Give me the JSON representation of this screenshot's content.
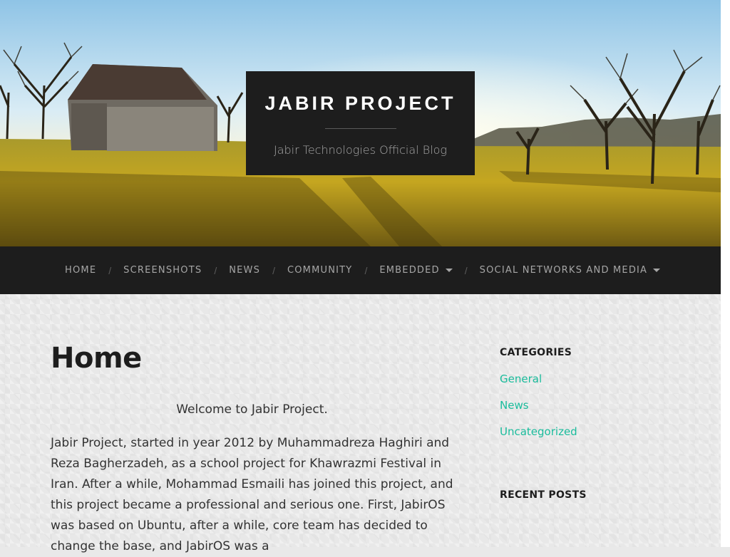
{
  "header": {
    "site_title": "JABIR PROJECT",
    "site_description": "Jabir Technologies Official Blog"
  },
  "nav": {
    "items": [
      {
        "label": "HOME"
      },
      {
        "label": "SCREENSHOTS"
      },
      {
        "label": "NEWS"
      },
      {
        "label": "COMMUNITY"
      },
      {
        "label": "EMBEDDED"
      },
      {
        "label": "SOCIAL NETWORKS AND MEDIA"
      }
    ],
    "separator": "/"
  },
  "main": {
    "page_title": "Home",
    "welcome": "Welcome to Jabir Project.",
    "body": "Jabir Project, started in year 2012 by Muhammadreza Haghiri and Reza Bagherzadeh, as a school project for Khawrazmi Festival in Iran. After a while, Mohammad Esmaili has joined this project, and this project became a professional and serious one. First, JabirOS was based on Ubuntu, after a while, core team has decided to change the base, and JabirOS was a"
  },
  "sidebar": {
    "categories_title": "CATEGORIES",
    "categories": [
      {
        "label": "General"
      },
      {
        "label": "News"
      },
      {
        "label": "Uncategorized"
      }
    ],
    "recent_posts_title": "RECENT POSTS"
  },
  "colors": {
    "accent": "#1abc9c",
    "dark_bar": "#1d1d1d",
    "nav_text": "#a6a6a6"
  }
}
